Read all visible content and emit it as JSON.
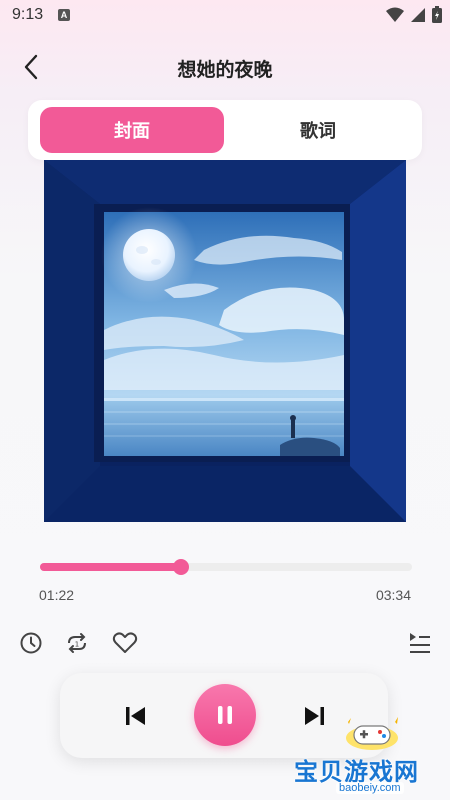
{
  "status_bar": {
    "time": "9:13",
    "app_icon_letter": "A",
    "icons": [
      "wifi-icon",
      "signal-icon",
      "battery-icon"
    ]
  },
  "header": {
    "title": "想她的夜晚",
    "back_icon": "chevron-left-icon"
  },
  "tabs": [
    {
      "label": "封面",
      "active": true
    },
    {
      "label": "歌词",
      "active": false
    }
  ],
  "cover": {
    "description_icon": "album-cover-image"
  },
  "player": {
    "current_time": "01:22",
    "total_time": "03:34",
    "progress": 0.38
  },
  "actions": {
    "timer_icon": "clock-icon",
    "repeat_icon": "repeat-icon",
    "favorite_icon": "heart-icon",
    "playlist_icon": "playlist-icon"
  },
  "controls": {
    "prev_icon": "skip-previous-icon",
    "play_icon": "pause-icon",
    "next_icon": "skip-next-icon"
  },
  "watermark": {
    "text": "宝贝游戏网",
    "url": "baobeiy.com"
  },
  "colors": {
    "accent": "#f25a97",
    "cover_blue": "#0c2a6e"
  }
}
